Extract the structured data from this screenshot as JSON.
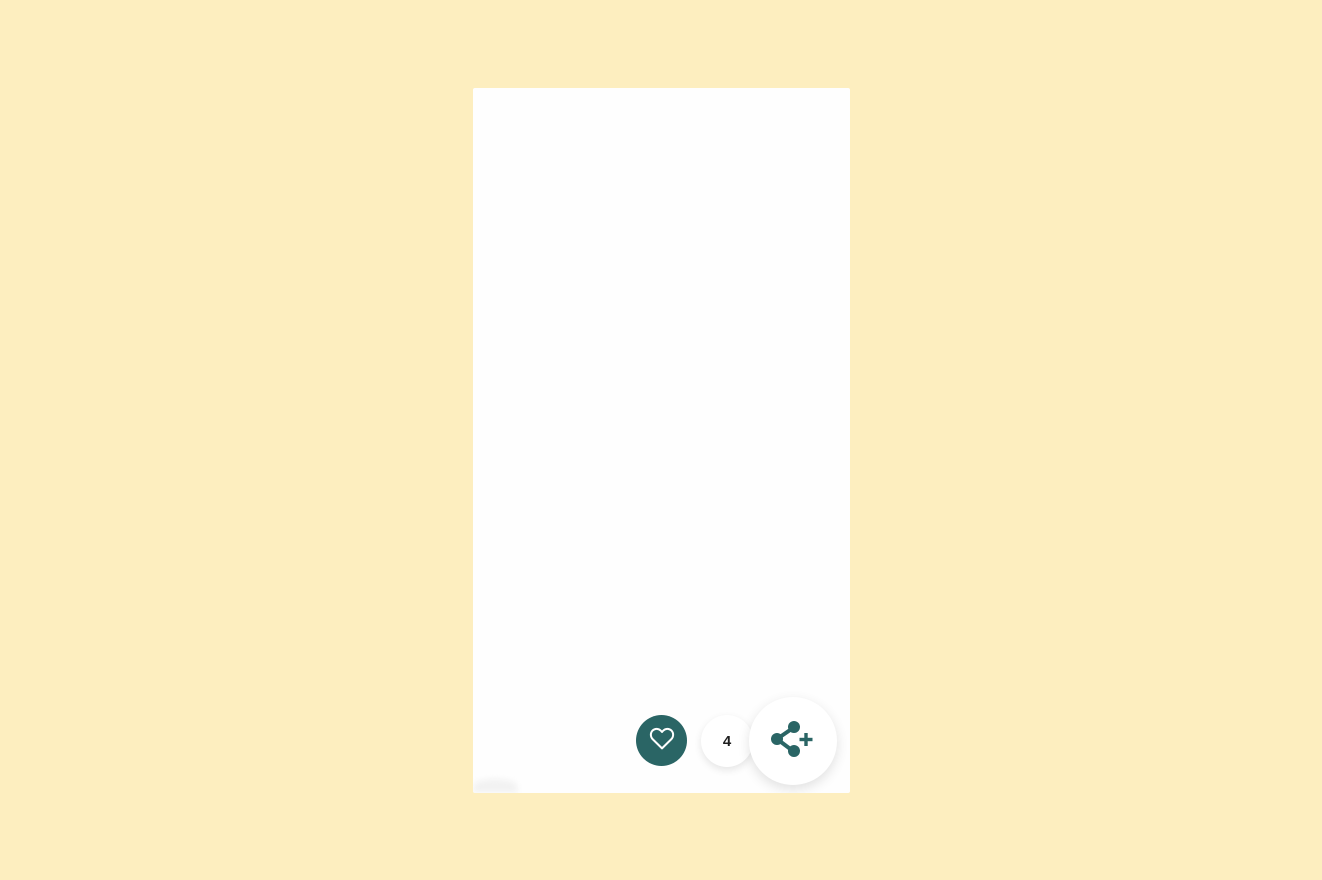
{
  "colors": {
    "page_background": "#fdeebf",
    "screen_background": "#fefefe",
    "accent": "#2a6565"
  },
  "actions": {
    "like": {
      "icon": "heart-outline-icon"
    },
    "count": "4",
    "share": {
      "icon": "share-plus-icon"
    }
  }
}
